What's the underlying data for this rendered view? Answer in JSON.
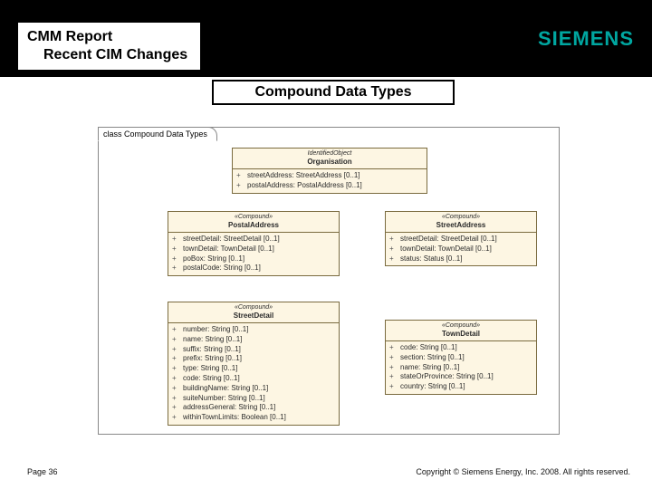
{
  "header": {
    "title_line1": "CMM Report",
    "title_line2": "Recent CIM Changes",
    "logo": "SIEMENS"
  },
  "banner": "Compound Data Types",
  "diagram": {
    "tab": "class Compound Data Types",
    "classes": {
      "org": {
        "stereo": "IdentifiedObject",
        "name": "Organisation",
        "attrs": [
          {
            "vis": "+",
            "text": "streetAddress: StreetAddress [0..1]"
          },
          {
            "vis": "+",
            "text": "postalAddress: PostalAddress [0..1]"
          }
        ]
      },
      "postal": {
        "stereo": "«Compound»",
        "name": "PostalAddress",
        "attrs": [
          {
            "vis": "+",
            "text": "streetDetail: StreetDetail [0..1]"
          },
          {
            "vis": "+",
            "text": "townDetail: TownDetail [0..1]"
          },
          {
            "vis": "+",
            "text": "poBox: String [0..1]"
          },
          {
            "vis": "+",
            "text": "postalCode: String [0..1]"
          }
        ]
      },
      "streetAddr": {
        "stereo": "«Compound»",
        "name": "StreetAddress",
        "attrs": [
          {
            "vis": "+",
            "text": "streetDetail: StreetDetail [0..1]"
          },
          {
            "vis": "+",
            "text": "townDetail: TownDetail [0..1]"
          },
          {
            "vis": "+",
            "text": "status: Status [0..1]"
          }
        ]
      },
      "streetDetail": {
        "stereo": "«Compound»",
        "name": "StreetDetail",
        "attrs": [
          {
            "vis": "+",
            "text": "number: String [0..1]"
          },
          {
            "vis": "+",
            "text": "name: String [0..1]"
          },
          {
            "vis": "+",
            "text": "suffix: String [0..1]"
          },
          {
            "vis": "+",
            "text": "prefix: String [0..1]"
          },
          {
            "vis": "+",
            "text": "type: String [0..1]"
          },
          {
            "vis": "+",
            "text": "code: String [0..1]"
          },
          {
            "vis": "+",
            "text": "buildingName: String [0..1]"
          },
          {
            "vis": "+",
            "text": "suiteNumber: String [0..1]"
          },
          {
            "vis": "+",
            "text": "addressGeneral: String [0..1]"
          },
          {
            "vis": "+",
            "text": "withinTownLimits: Boolean [0..1]"
          }
        ]
      },
      "townDetail": {
        "stereo": "«Compound»",
        "name": "TownDetail",
        "attrs": [
          {
            "vis": "+",
            "text": "code: String [0..1]"
          },
          {
            "vis": "+",
            "text": "section: String [0..1]"
          },
          {
            "vis": "+",
            "text": "name: String [0..1]"
          },
          {
            "vis": "+",
            "text": "stateOrProvince: String [0..1]"
          },
          {
            "vis": "+",
            "text": "country: String [0..1]"
          }
        ]
      }
    }
  },
  "footer": {
    "page": "Page 36",
    "copyright": "Copyright © Siemens Energy, Inc. 2008. All rights reserved."
  }
}
